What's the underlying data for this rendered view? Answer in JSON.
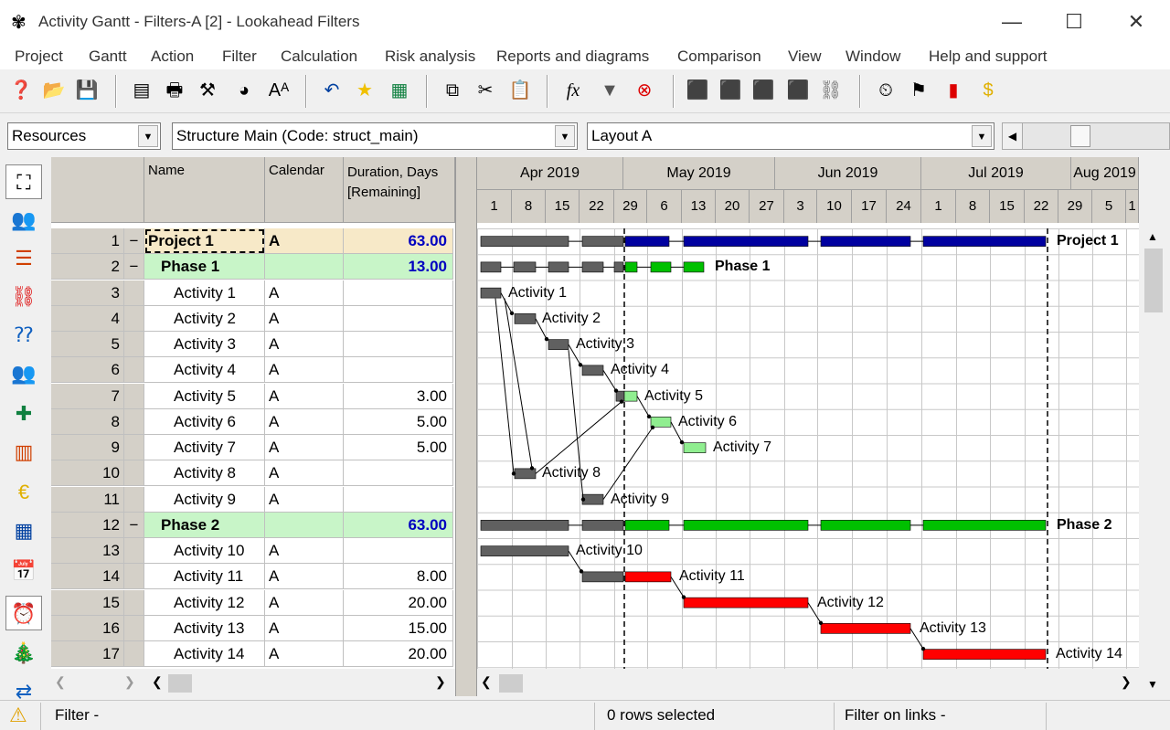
{
  "window": {
    "title": "Activity Gantt - Filters-A [2] - Lookahead Filters"
  },
  "menu": [
    "Project",
    "Gantt",
    "Action",
    "Filter",
    "Calculation",
    "Risk analysis",
    "Reports and diagrams",
    "Comparison",
    "View",
    "Window",
    "Help and support"
  ],
  "combos": {
    "resources": "Resources",
    "structure": "Structure Main (Code: struct_main)",
    "layout": "Layout A"
  },
  "columns": {
    "name": "Name",
    "calendar": "Calendar",
    "duration": "Duration, Days [Remaining]"
  },
  "months": [
    "Apr 2019",
    "May 2019",
    "Jun 2019",
    "Jul 2019",
    "Aug 2019"
  ],
  "days": [
    "1",
    "8",
    "15",
    "22",
    "29",
    "6",
    "13",
    "20",
    "27",
    "3",
    "10",
    "17",
    "24",
    "1",
    "8",
    "15",
    "22",
    "29",
    "5",
    "1"
  ],
  "rows": [
    {
      "num": "1",
      "exp": "−",
      "name": "Project 1",
      "cal": "A",
      "dur": "63.00",
      "type": "project"
    },
    {
      "num": "2",
      "exp": "−",
      "name": "Phase 1",
      "cal": "",
      "dur": "13.00",
      "type": "phase"
    },
    {
      "num": "3",
      "exp": "",
      "name": "Activity 1",
      "cal": "A",
      "dur": "",
      "type": "act"
    },
    {
      "num": "4",
      "exp": "",
      "name": "Activity 2",
      "cal": "A",
      "dur": "",
      "type": "act"
    },
    {
      "num": "5",
      "exp": "",
      "name": "Activity 3",
      "cal": "A",
      "dur": "",
      "type": "act"
    },
    {
      "num": "6",
      "exp": "",
      "name": "Activity 4",
      "cal": "A",
      "dur": "",
      "type": "act"
    },
    {
      "num": "7",
      "exp": "",
      "name": "Activity 5",
      "cal": "A",
      "dur": "3.00",
      "type": "act"
    },
    {
      "num": "8",
      "exp": "",
      "name": "Activity 6",
      "cal": "A",
      "dur": "5.00",
      "type": "act"
    },
    {
      "num": "9",
      "exp": "",
      "name": "Activity 7",
      "cal": "A",
      "dur": "5.00",
      "type": "act"
    },
    {
      "num": "10",
      "exp": "",
      "name": "Activity 8",
      "cal": "A",
      "dur": "",
      "type": "act"
    },
    {
      "num": "11",
      "exp": "",
      "name": "Activity 9",
      "cal": "A",
      "dur": "",
      "type": "act"
    },
    {
      "num": "12",
      "exp": "−",
      "name": "Phase 2",
      "cal": "",
      "dur": "63.00",
      "type": "phase"
    },
    {
      "num": "13",
      "exp": "",
      "name": "Activity 10",
      "cal": "A",
      "dur": "",
      "type": "act"
    },
    {
      "num": "14",
      "exp": "",
      "name": "Activity 11",
      "cal": "A",
      "dur": "8.00",
      "type": "act"
    },
    {
      "num": "15",
      "exp": "",
      "name": "Activity 12",
      "cal": "A",
      "dur": "20.00",
      "type": "act"
    },
    {
      "num": "16",
      "exp": "",
      "name": "Activity 13",
      "cal": "A",
      "dur": "15.00",
      "type": "act"
    },
    {
      "num": "17",
      "exp": "",
      "name": "Activity 14",
      "cal": "A",
      "dur": "20.00",
      "type": "act"
    }
  ],
  "bar_labels": [
    "Project 1",
    "Phase 1",
    "Activity 1",
    "Activity 2",
    "Activity 3",
    "Activity 4",
    "Activity 5",
    "Activity 6",
    "Activity 7",
    "Activity 8",
    "Activity 9",
    "Phase 2",
    "Activity 10",
    "Activity 11",
    "Activity 12",
    "Activity 13",
    "Activity 14"
  ],
  "status": {
    "filter": "Filter -",
    "selected": "0 rows selected",
    "links": "Filter on links -"
  },
  "colors": {
    "completed": "#606060",
    "summary": "#0000a0",
    "phase_remaining": "#00c000",
    "remaining": "#90ee90",
    "critical": "#ff0000",
    "project_row": "#f7e9c8",
    "phase_row": "#c8f5c8",
    "duration_blue": "#0000c0"
  }
}
